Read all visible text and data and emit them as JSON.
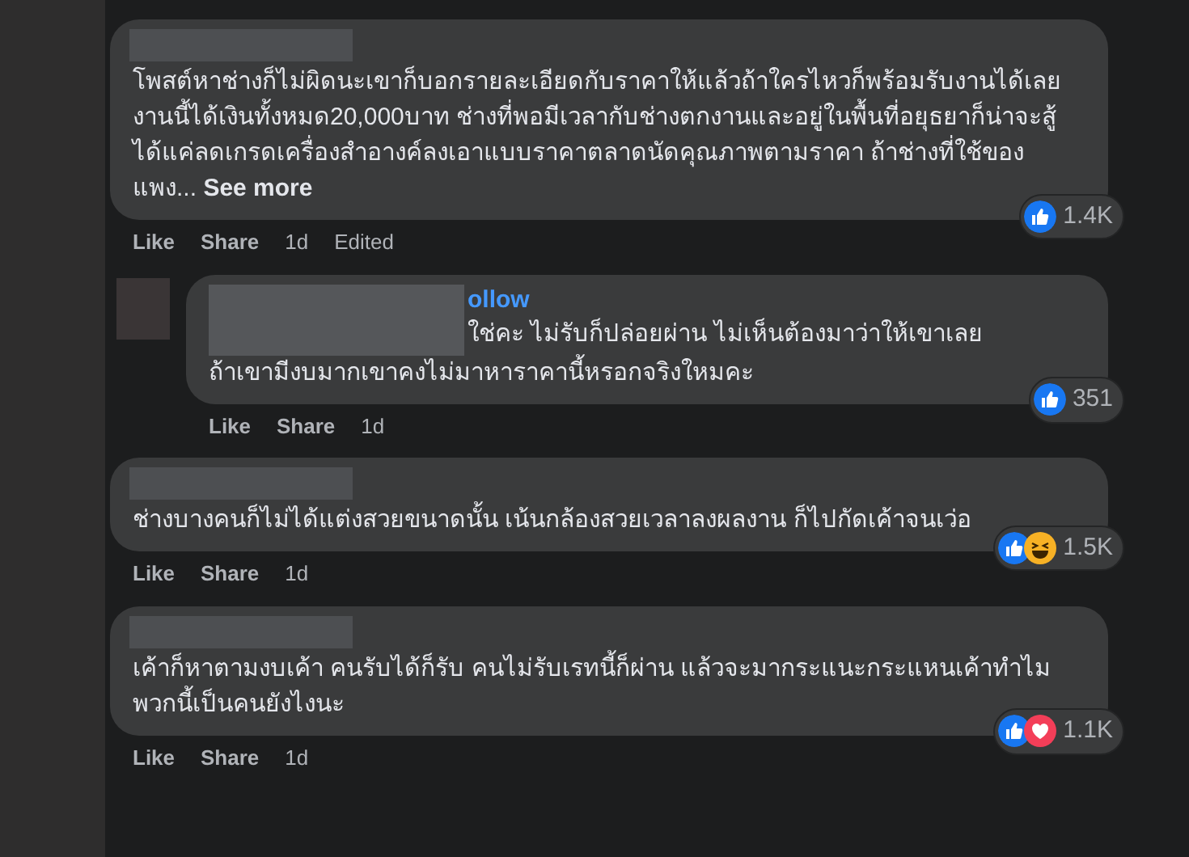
{
  "comments": [
    {
      "kind": "comment",
      "text": "โพสต์หาช่างก็ไม่ผิดนะเขาก็บอกรายละเอียดกับราคาให้แล้วถ้าใครไหวก็พร้อมรับงานได้เลยงานนี้ได้เงินทั้งหมด20,000บาท ช่างที่พอมีเวลากับช่างตกงานและอยู่ในพื้นที่อยุธยาก็น่าจะสู้ได้แค่ลดเกรดเครื่องสำอางค์ลงเอาแบบราคาตลาดนัดคุณภาพตามราคา ถ้าช่างที่ใช้ของแพง...",
      "see_more": "See more",
      "actions": [
        "Like",
        "Share"
      ],
      "time": "1d",
      "edited": "Edited",
      "reactions": [
        {
          "kind": "like"
        }
      ],
      "count": "1.4K"
    },
    {
      "kind": "reply",
      "follow": "ollow",
      "lines": [
        "ใช่คะ ไม่รับก็ปล่อยผ่าน ไม่เห็นต้องมาว่าให้เขาเลย",
        "ถ้าเขามีงบมากเขาคงไม่มาหาราคานี้หรอกจริงใหมคะ"
      ],
      "actions": [
        "Like",
        "Share"
      ],
      "time": "1d",
      "reactions": [
        {
          "kind": "like"
        }
      ],
      "count": "351"
    },
    {
      "kind": "comment",
      "text": "ช่างบางคนก็ไม่ได้แต่งสวยขนาดนั้น เน้นกล้องสวยเวลาลงผลงาน ก็ไปกัดเค้าจนเว่อ",
      "actions": [
        "Like",
        "Share"
      ],
      "time": "1d",
      "reactions": [
        {
          "kind": "like"
        },
        {
          "kind": "haha"
        }
      ],
      "count": "1.5K"
    },
    {
      "kind": "comment",
      "text": "เค้าก็หาตามงบเค้า คนรับได้ก็รับ คนไม่รับเรทนี้ก็ผ่าน แล้วจะมากระแนะกระแหนเค้าทำไม พวกนี้เป็นคนยังไงนะ",
      "actions": [
        "Like",
        "Share"
      ],
      "time": "1d",
      "reactions": [
        {
          "kind": "like"
        },
        {
          "kind": "love"
        }
      ],
      "count": "1.1K"
    }
  ]
}
